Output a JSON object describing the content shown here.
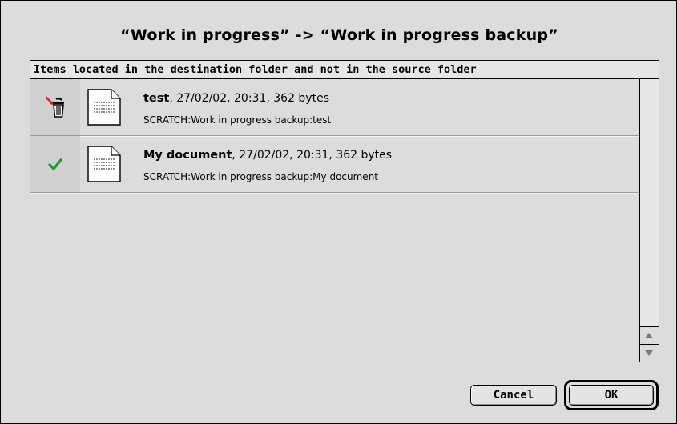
{
  "dialog": {
    "title": "“Work in progress”  ->  “Work in progress backup”"
  },
  "panel": {
    "header": "Items located in the destination folder and not in the source folder",
    "items": [
      {
        "status_icon": "trash-can-icon",
        "file_icon": "document-icon",
        "name": "test",
        "details": ", 27/02/02, 20:31, 362 bytes",
        "path": "SCRATCH:Work in progress backup:test"
      },
      {
        "status_icon": "green-checkmark-icon",
        "file_icon": "document-icon",
        "name": "My document",
        "details": ", 27/02/02, 20:31, 362 bytes",
        "path": "SCRATCH:Work in progress backup:My document"
      }
    ]
  },
  "buttons": {
    "cancel_label": "Cancel",
    "ok_label": "OK"
  },
  "colors": {
    "dialog_background": "#dcdcdc",
    "check_green": "#1f9a2a",
    "delete_arrow_red": "#d8202a"
  }
}
